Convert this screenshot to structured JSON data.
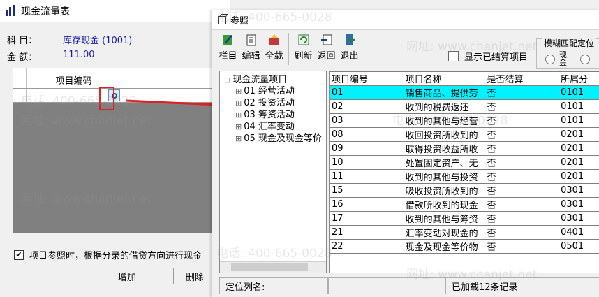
{
  "main_window": {
    "title": "现金流量表",
    "subject_label": "科  目：",
    "subject_value": "库存现金 (1001)",
    "amount_label": "金  额：",
    "amount_value": "111.00",
    "grid_header": "项目编码",
    "checkbox_checked": true,
    "checkbox_mark": "✔",
    "checkbox_label": "项目参照时，根据分录的借贷方向进行现金",
    "add_button": "增加",
    "delete_button": "删除"
  },
  "ref_window": {
    "title": "参照",
    "toolbar": [
      "栏目",
      "编辑",
      "全载",
      "刷新",
      "返回",
      "退出"
    ],
    "show_settled_label": "显示已结算项目",
    "fuzzy_label": "模糊匹配定位",
    "radio_labels": [
      "现\n金",
      ""
    ],
    "tree": {
      "root": "现金流量项目",
      "items": [
        "01  经营活动",
        "02  投资活动",
        "03  筹资活动",
        "04  汇率变动",
        "05  现金及现金等价"
      ]
    },
    "columns": [
      "项目编号",
      "项目名称",
      "是否结算",
      "所属分"
    ],
    "rows": [
      [
        "01",
        "销售商品、提供劳",
        "否",
        "0101"
      ],
      [
        "02",
        "收到的税费返还",
        "否",
        "0101"
      ],
      [
        "03",
        "收到的其他与经营",
        "否",
        "0101"
      ],
      [
        "08",
        "收回投资所收到的",
        "否",
        "0201"
      ],
      [
        "09",
        "取得投资收益所收",
        "否",
        "0201"
      ],
      [
        "10",
        "处置固定资产、无",
        "否",
        "0201"
      ],
      [
        "11",
        "收到的其他与投资",
        "否",
        "0201"
      ],
      [
        "15",
        "吸收投资所收到的",
        "否",
        "0301"
      ],
      [
        "16",
        "借款所收到的现金",
        "否",
        "0301"
      ],
      [
        "17",
        "收到的其他与筹资",
        "否",
        "0301"
      ],
      [
        "21",
        "汇率变动对现金的",
        "否",
        "0401"
      ],
      [
        "22",
        "现金及现金等价物",
        "否",
        "0501"
      ]
    ],
    "status_locate_label": "定位列名:",
    "status_loaded": "已加载12条记录"
  },
  "watermark": {
    "phone": "电话: 400-665-0028",
    "site": "网址: www.chanjet.net"
  },
  "colors": {
    "selected_row": "#00f2ff",
    "value_text": "#1a1aa6",
    "arrow": "#e02020"
  }
}
